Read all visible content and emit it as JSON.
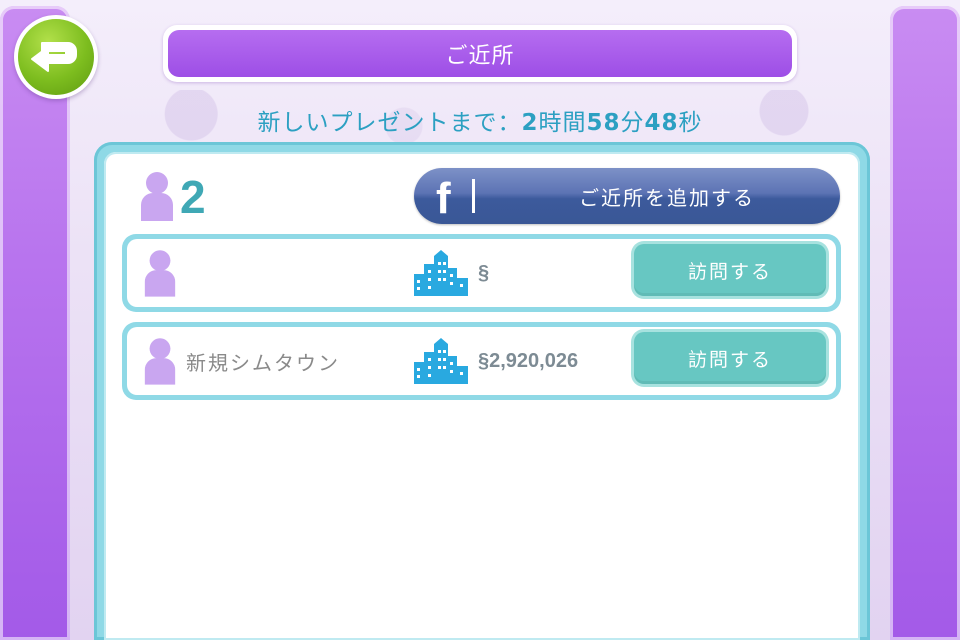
{
  "header": {
    "title": "ご近所",
    "back_icon": "back-arrow-icon"
  },
  "gift_timer": {
    "prefix": "新しいプレゼントまで：",
    "hours": "2",
    "hours_unit": "時間",
    "minutes": "58",
    "minutes_unit": "分",
    "seconds": "48",
    "seconds_unit": "秒"
  },
  "summary": {
    "neighbor_count": "2",
    "add_button_label": "ご近所を追加する",
    "add_button_icon": "facebook-icon"
  },
  "neighbors": [
    {
      "name": "",
      "simoleons": "§",
      "visit_label": "訪問する"
    },
    {
      "name": "新規シムタウン",
      "simoleons": "§2,920,026",
      "visit_label": "訪問する"
    }
  ],
  "colors": {
    "purple_accent": "#a35ae8",
    "teal_border": "#8fd9e6",
    "visit_button": "#67c7c2",
    "facebook_blue": "#3b5998",
    "timer_text": "#2ca0c2",
    "back_button_green": "#7dbd1f",
    "person_icon": "#c9a6f0",
    "city_icon": "#29a9e0"
  }
}
